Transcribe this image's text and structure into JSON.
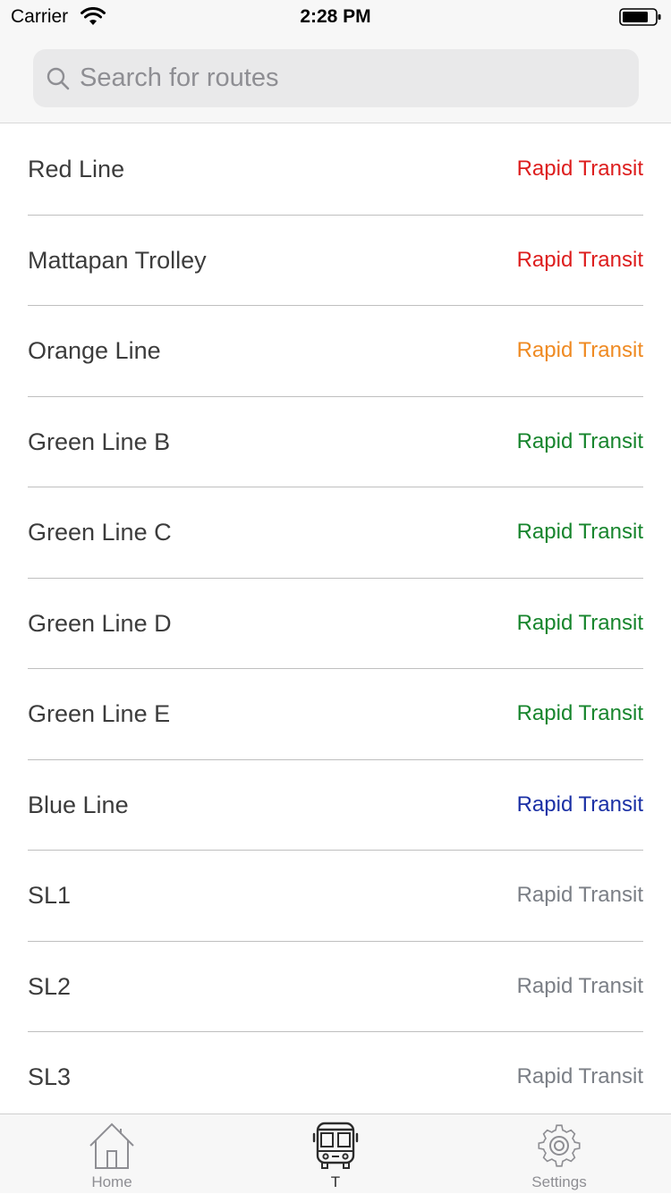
{
  "status_bar": {
    "carrier": "Carrier",
    "time": "2:28 PM"
  },
  "search": {
    "placeholder": "Search for routes",
    "value": ""
  },
  "colors": {
    "red": "#dd1d1d",
    "orange": "#ef8a22",
    "green": "#17852d",
    "blue": "#1b30a5",
    "gray": "#7b7f86"
  },
  "routes": [
    {
      "name": "Red Line",
      "type": "Rapid Transit",
      "color": "#dd1d1d"
    },
    {
      "name": "Mattapan Trolley",
      "type": "Rapid Transit",
      "color": "#dd1d1d"
    },
    {
      "name": "Orange Line",
      "type": "Rapid Transit",
      "color": "#ef8a22"
    },
    {
      "name": "Green Line B",
      "type": "Rapid Transit",
      "color": "#17852d"
    },
    {
      "name": "Green Line C",
      "type": "Rapid Transit",
      "color": "#17852d"
    },
    {
      "name": "Green Line D",
      "type": "Rapid Transit",
      "color": "#17852d"
    },
    {
      "name": "Green Line E",
      "type": "Rapid Transit",
      "color": "#17852d"
    },
    {
      "name": "Blue Line",
      "type": "Rapid Transit",
      "color": "#1b30a5"
    },
    {
      "name": "SL1",
      "type": "Rapid Transit",
      "color": "#7b7f86"
    },
    {
      "name": "SL2",
      "type": "Rapid Transit",
      "color": "#7b7f86"
    },
    {
      "name": "SL3",
      "type": "Rapid Transit",
      "color": "#7b7f86"
    }
  ],
  "tabs": [
    {
      "label": "Home",
      "icon": "house-icon",
      "active": false
    },
    {
      "label": "T",
      "icon": "bus-icon",
      "active": true
    },
    {
      "label": "Settings",
      "icon": "gear-icon",
      "active": false
    }
  ]
}
